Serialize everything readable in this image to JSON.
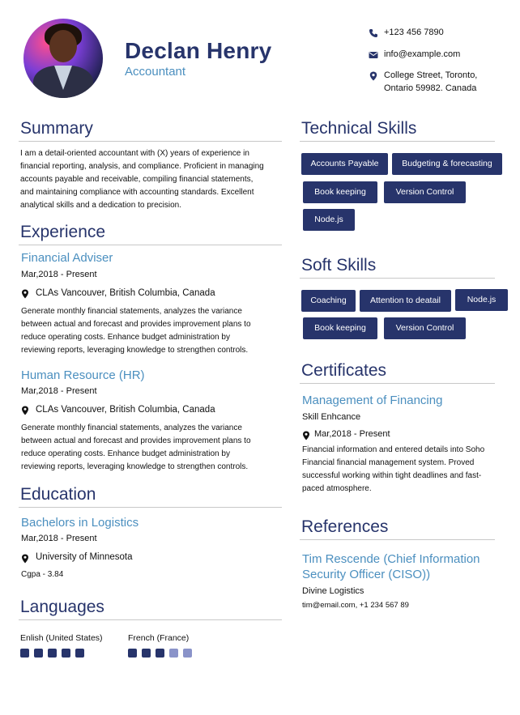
{
  "header": {
    "name": "Declan Henry",
    "role": "Accountant",
    "phone": "+123 456 7890",
    "email": "info@example.com",
    "address_line1": "College Street, Toronto,",
    "address_line2": "Ontario 59982. Canada"
  },
  "summary": {
    "title": "Summary",
    "lines": [
      "I am a detail-oriented accountant with (X) years of experience in",
      "financial reporting, analysis, and compliance. Proficient in managing",
      "accounts payable and receivable, compiling financial statements,",
      "and maintaining compliance with accounting standards. Excellent",
      "analytical skills and a dedication to precision."
    ]
  },
  "experience": {
    "title": "Experience",
    "jobs": [
      {
        "title": "Financial Adviser",
        "date": "Mar,2018 - Present",
        "location": "CLAs Vancouver, British Columbia, Canada",
        "lines": [
          "Generate monthly financial statements, analyzes the variance",
          "between actual and forecast and provides improvement plans to",
          "reduce operating costs. Enhance budget administration by",
          "reviewing reports, leveraging knowledge to strengthen controls."
        ]
      },
      {
        "title": "Human Resource (HR)",
        "date": "Mar,2018 - Present",
        "location": "CLAs Vancouver, British Columbia, Canada",
        "lines": [
          "Generate monthly financial statements, analyzes the variance",
          "between actual and forecast and provides improvement plans to",
          "reduce operating costs. Enhance budget administration by",
          "reviewing reports, leveraging knowledge to strengthen controls."
        ]
      }
    ]
  },
  "education": {
    "title": "Education",
    "degree": "Bachelors in Logistics",
    "date": "Mar,2018 - Present",
    "school": "University of Minnesota",
    "gpa": "Cgpa - 3.84"
  },
  "languages": {
    "title": "Languages",
    "items": [
      {
        "name": "Enlish (United States)",
        "level": 5,
        "max": 5
      },
      {
        "name": "French (France)",
        "level": 3,
        "max": 5
      }
    ]
  },
  "technical_skills": {
    "title": "Technical Skills",
    "items": [
      "Accounts Payable",
      "Budgeting & forecasting",
      "Book keeping",
      "Version Control",
      "Node.js"
    ]
  },
  "soft_skills": {
    "title": "Soft Skills",
    "items": [
      "Coaching",
      "Attention to deatail",
      "Node.js",
      "Book keeping",
      "Version Control"
    ]
  },
  "certificates": {
    "title": "Certificates",
    "name": "Management of Financing",
    "issuer": "Skill Enhcance",
    "date": "Mar,2018 - Present",
    "lines": [
      "Financial information and entered details into Soho",
      "Financial financial management system. Proved",
      "successful working within tight deadlines and fast-",
      "paced atmosphere."
    ]
  },
  "references": {
    "title": "References",
    "name_line1": "Tim Rescende (Chief Information",
    "name_line2": "Security Officer (CISO))",
    "company": "Divine Logistics",
    "contact": "tim@email.com, +1 234 567 89"
  },
  "colors": {
    "navy": "#27346b",
    "accent_blue": "#4b8fbf",
    "dot_empty": "#8a93c9"
  }
}
